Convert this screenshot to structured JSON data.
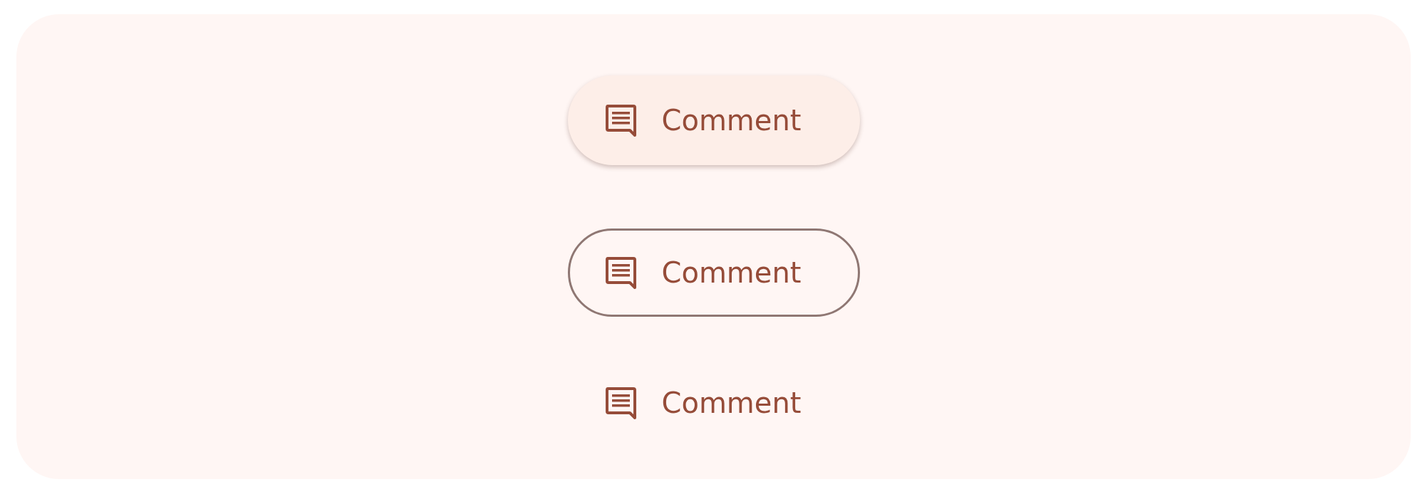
{
  "buttons": [
    {
      "kind": "elevated",
      "label": "Comment"
    },
    {
      "kind": "outlined",
      "label": "Comment"
    },
    {
      "kind": "text",
      "label": "Comment"
    }
  ]
}
